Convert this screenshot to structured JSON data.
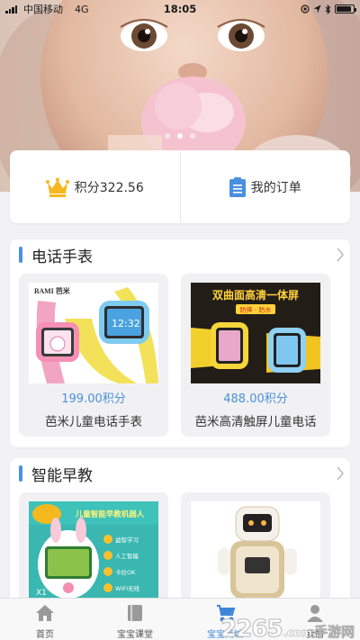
{
  "status_bar": {
    "carrier": "中国移动",
    "network": "4G",
    "time": "18:05",
    "battery_level": 0.9
  },
  "banner": {
    "slides": 3,
    "active_slide": 1
  },
  "points_card": {
    "points_label": "积分322.56",
    "orders_label": "我的订单",
    "accent_color": "#f5b820",
    "orders_icon_color": "#4a8fe0"
  },
  "sections": [
    {
      "title": "电话手表",
      "products": [
        {
          "brand": "BAMI 芭米",
          "price": "199.00积分",
          "name": "芭米儿童电话手表",
          "screen_time": "12:32"
        },
        {
          "brand_banner": "双曲面高清一体屏",
          "tags": "防摔 · 防水",
          "price": "488.00积分",
          "name": "芭米高清触屏儿童电话"
        }
      ]
    },
    {
      "title": "智能早教",
      "products": [
        {
          "headline": "儿童智能早教机器人",
          "model": "X1",
          "features": [
            "益智学习",
            "人工智能",
            "卡拉OK",
            "WIFI无线"
          ]
        },
        {}
      ]
    }
  ],
  "tabs": [
    {
      "label": "首页",
      "icon": "home-icon",
      "active": false
    },
    {
      "label": "宝宝课堂",
      "icon": "book-icon",
      "active": false
    },
    {
      "label": "宝宝商城",
      "icon": "stroller-icon",
      "active": true
    },
    {
      "label": "我的",
      "icon": "user-icon",
      "active": false
    }
  ],
  "watermark": {
    "number": "2265",
    "dotcom": ".com",
    "text": "手游网"
  },
  "colors": {
    "accent": "#4a90e2",
    "price": "#4a90d9",
    "background": "#f2f2f4"
  }
}
